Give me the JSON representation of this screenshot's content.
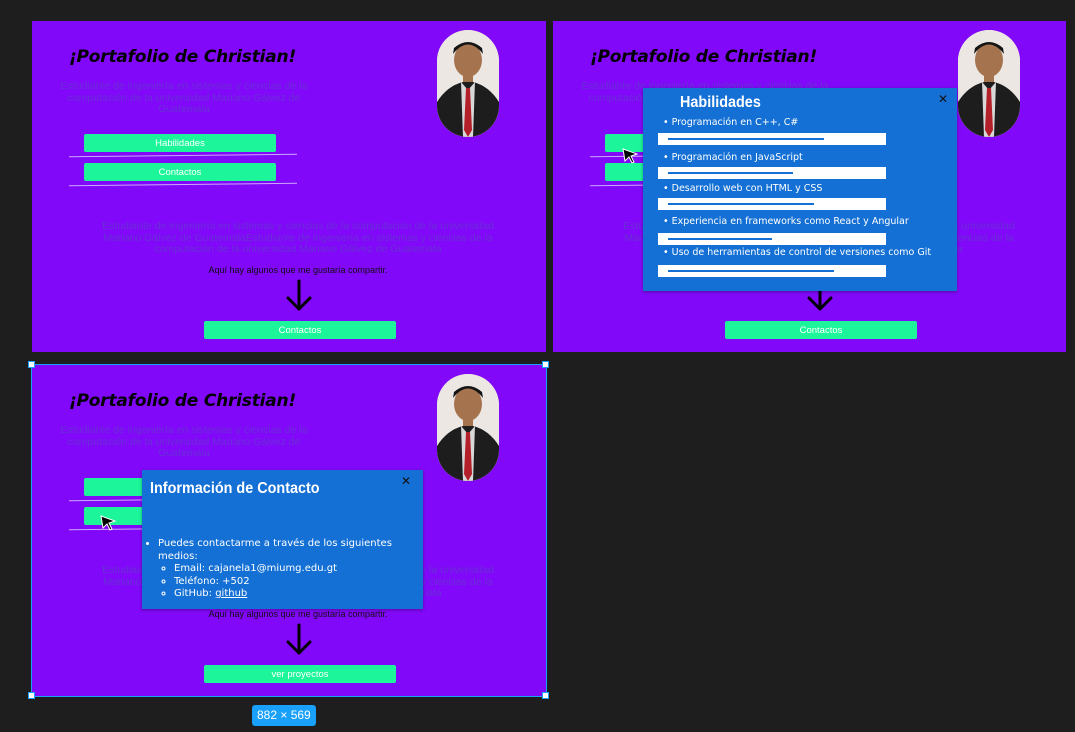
{
  "portfolio": {
    "title": "¡Portafolio de Christian!",
    "subtitle": "Estudiante de ingeniería en sistemas y ciencias de la computación de la universidad Mariano Gálvez de Guatemala",
    "skills_button": "Habilidades",
    "contacts_button": "Contactos",
    "paragraph": "Estudiante de ingeniería en sistemas y ciencias de la computación de la universidad Mariano Gálvez de GuatemalaEstudiante de ingeniería en sistemas y ciencias de la computación de la universidad Mariano Gálvez de Guatemala",
    "share_text": "Aquí hay algunos que me gustaría compartir.",
    "bottom_button_frame1": "Contactos",
    "bottom_button_frame2": "Contactos",
    "bottom_button_frame3": "ver proyectos"
  },
  "skills_modal": {
    "title": "Habilidades",
    "close": "✕",
    "items": [
      {
        "label": "Programación en C++, C#",
        "level": 0.75
      },
      {
        "label": "Programación en JavaScript",
        "level": 0.6
      },
      {
        "label": "Desarrollo web con HTML y CSS",
        "level": 0.7
      },
      {
        "label": "Experiencia en frameworks como React y Angular",
        "level": 0.5
      },
      {
        "label": "Uso de herramientas de control de versiones como Git",
        "level": 0.8
      }
    ]
  },
  "contact_modal": {
    "title": "Información de Contacto",
    "close": "✕",
    "intro": "Puedes contactarme a través de los siguientes medios:",
    "email": "Email: cajanela1@miumg.edu.gt",
    "phone": "Teléfono: +502",
    "github_prefix": "GitHub: ",
    "github_link": "github"
  },
  "selection": {
    "dimensions": "882 × 569"
  },
  "colors": {
    "canvas": "#1e1e1e",
    "frame_bg": "#8108f8",
    "button": "#1cf59a",
    "modal": "#1470d4",
    "selection": "#18a0fb"
  },
  "icons": [
    "arrow-down-icon",
    "close-icon",
    "cursor-icon"
  ]
}
